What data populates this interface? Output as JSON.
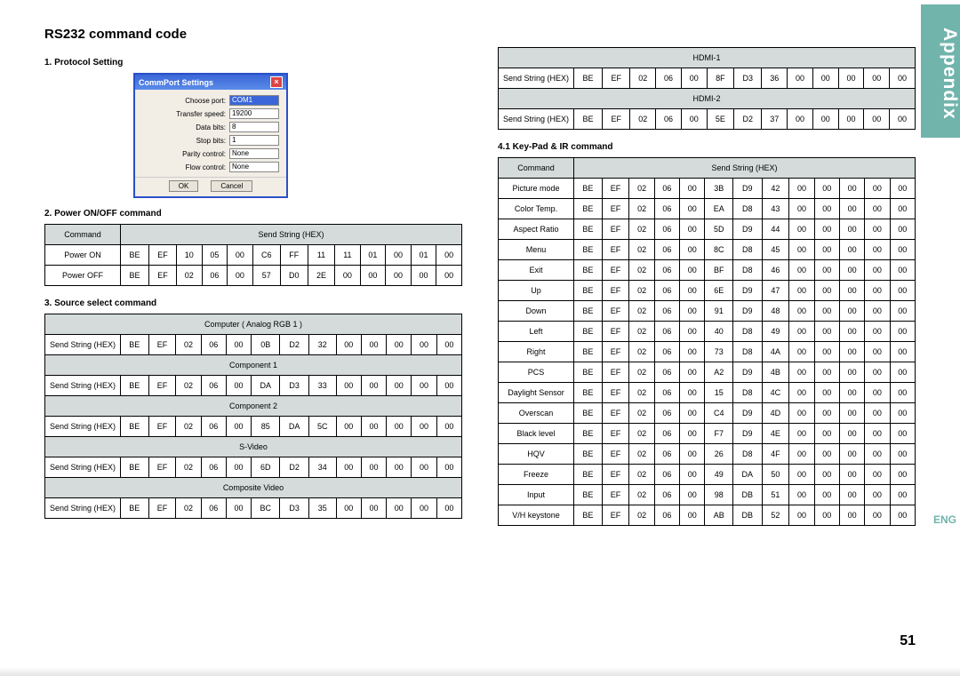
{
  "tab": "Appendix",
  "lang": "ENG",
  "title": "RS232 command code",
  "page_number": "51",
  "protocol": {
    "heading": "1. Protocol Setting",
    "dialog_title": "CommPort Settings",
    "fields": [
      {
        "label": "Choose port:",
        "value": "COM1",
        "hl": true
      },
      {
        "label": "Transfer speed:",
        "value": "19200"
      },
      {
        "label": "Data bits:",
        "value": "8"
      },
      {
        "label": "Stop bits:",
        "value": "1"
      },
      {
        "label": "Parity control:",
        "value": "None"
      },
      {
        "label": "Flow control:",
        "value": "None"
      }
    ],
    "ok": "OK",
    "cancel": "Cancel"
  },
  "power": {
    "heading": "2. Power ON/OFF command",
    "col_command": "Command",
    "col_send": "Send String (HEX)",
    "rows": [
      {
        "name": "Power ON",
        "hex": [
          "BE",
          "EF",
          "10",
          "05",
          "00",
          "C6",
          "FF",
          "11",
          "11",
          "01",
          "00",
          "01",
          "00"
        ]
      },
      {
        "name": "Power OFF",
        "hex": [
          "BE",
          "EF",
          "02",
          "06",
          "00",
          "57",
          "D0",
          "2E",
          "00",
          "00",
          "00",
          "00",
          "00"
        ]
      }
    ]
  },
  "source": {
    "heading": "3. Source select command",
    "label": "Send String (HEX)",
    "groups_left": [
      {
        "title": "Computer  ( Analog RGB 1 )",
        "hex": [
          "BE",
          "EF",
          "02",
          "06",
          "00",
          "0B",
          "D2",
          "32",
          "00",
          "00",
          "00",
          "00",
          "00"
        ]
      },
      {
        "title": "Component 1",
        "hex": [
          "BE",
          "EF",
          "02",
          "06",
          "00",
          "DA",
          "D3",
          "33",
          "00",
          "00",
          "00",
          "00",
          "00"
        ]
      },
      {
        "title": "Component 2",
        "hex": [
          "BE",
          "EF",
          "02",
          "06",
          "00",
          "85",
          "DA",
          "5C",
          "00",
          "00",
          "00",
          "00",
          "00"
        ]
      },
      {
        "title": "S-Video",
        "hex": [
          "BE",
          "EF",
          "02",
          "06",
          "00",
          "6D",
          "D2",
          "34",
          "00",
          "00",
          "00",
          "00",
          "00"
        ]
      },
      {
        "title": "Composite Video",
        "hex": [
          "BE",
          "EF",
          "02",
          "06",
          "00",
          "BC",
          "D3",
          "35",
          "00",
          "00",
          "00",
          "00",
          "00"
        ]
      }
    ],
    "groups_right": [
      {
        "title": "HDMI-1",
        "hex": [
          "BE",
          "EF",
          "02",
          "06",
          "00",
          "8F",
          "D3",
          "36",
          "00",
          "00",
          "00",
          "00",
          "00"
        ]
      },
      {
        "title": "HDMI-2",
        "hex": [
          "BE",
          "EF",
          "02",
          "06",
          "00",
          "5E",
          "D2",
          "37",
          "00",
          "00",
          "00",
          "00",
          "00"
        ]
      }
    ]
  },
  "keypad": {
    "heading": "4.1 Key-Pad & IR command",
    "col_command": "Command",
    "col_send": "Send String (HEX)",
    "rows": [
      {
        "name": "Picture mode",
        "hex": [
          "BE",
          "EF",
          "02",
          "06",
          "00",
          "3B",
          "D9",
          "42",
          "00",
          "00",
          "00",
          "00",
          "00"
        ]
      },
      {
        "name": "Color Temp.",
        "hex": [
          "BE",
          "EF",
          "02",
          "06",
          "00",
          "EA",
          "D8",
          "43",
          "00",
          "00",
          "00",
          "00",
          "00"
        ]
      },
      {
        "name": "Aspect Ratio",
        "hex": [
          "BE",
          "EF",
          "02",
          "06",
          "00",
          "5D",
          "D9",
          "44",
          "00",
          "00",
          "00",
          "00",
          "00"
        ]
      },
      {
        "name": "Menu",
        "hex": [
          "BE",
          "EF",
          "02",
          "06",
          "00",
          "8C",
          "D8",
          "45",
          "00",
          "00",
          "00",
          "00",
          "00"
        ]
      },
      {
        "name": "Exit",
        "hex": [
          "BE",
          "EF",
          "02",
          "06",
          "00",
          "BF",
          "D8",
          "46",
          "00",
          "00",
          "00",
          "00",
          "00"
        ]
      },
      {
        "name": "Up",
        "hex": [
          "BE",
          "EF",
          "02",
          "06",
          "00",
          "6E",
          "D9",
          "47",
          "00",
          "00",
          "00",
          "00",
          "00"
        ]
      },
      {
        "name": "Down",
        "hex": [
          "BE",
          "EF",
          "02",
          "06",
          "00",
          "91",
          "D9",
          "48",
          "00",
          "00",
          "00",
          "00",
          "00"
        ]
      },
      {
        "name": "Left",
        "hex": [
          "BE",
          "EF",
          "02",
          "06",
          "00",
          "40",
          "D8",
          "49",
          "00",
          "00",
          "00",
          "00",
          "00"
        ]
      },
      {
        "name": "Right",
        "hex": [
          "BE",
          "EF",
          "02",
          "06",
          "00",
          "73",
          "D8",
          "4A",
          "00",
          "00",
          "00",
          "00",
          "00"
        ]
      },
      {
        "name": "PCS",
        "hex": [
          "BE",
          "EF",
          "02",
          "06",
          "00",
          "A2",
          "D9",
          "4B",
          "00",
          "00",
          "00",
          "00",
          "00"
        ]
      },
      {
        "name": "Daylight Sensor",
        "hex": [
          "BE",
          "EF",
          "02",
          "06",
          "00",
          "15",
          "D8",
          "4C",
          "00",
          "00",
          "00",
          "00",
          "00"
        ]
      },
      {
        "name": "Overscan",
        "hex": [
          "BE",
          "EF",
          "02",
          "06",
          "00",
          "C4",
          "D9",
          "4D",
          "00",
          "00",
          "00",
          "00",
          "00"
        ]
      },
      {
        "name": "Black level",
        "hex": [
          "BE",
          "EF",
          "02",
          "06",
          "00",
          "F7",
          "D9",
          "4E",
          "00",
          "00",
          "00",
          "00",
          "00"
        ]
      },
      {
        "name": "HQV",
        "hex": [
          "BE",
          "EF",
          "02",
          "06",
          "00",
          "26",
          "D8",
          "4F",
          "00",
          "00",
          "00",
          "00",
          "00"
        ]
      },
      {
        "name": "Freeze",
        "hex": [
          "BE",
          "EF",
          "02",
          "06",
          "00",
          "49",
          "DA",
          "50",
          "00",
          "00",
          "00",
          "00",
          "00"
        ]
      },
      {
        "name": "Input",
        "hex": [
          "BE",
          "EF",
          "02",
          "06",
          "00",
          "98",
          "DB",
          "51",
          "00",
          "00",
          "00",
          "00",
          "00"
        ]
      },
      {
        "name": "V/H keystone",
        "hex": [
          "BE",
          "EF",
          "02",
          "06",
          "00",
          "AB",
          "DB",
          "52",
          "00",
          "00",
          "00",
          "00",
          "00"
        ]
      }
    ]
  }
}
